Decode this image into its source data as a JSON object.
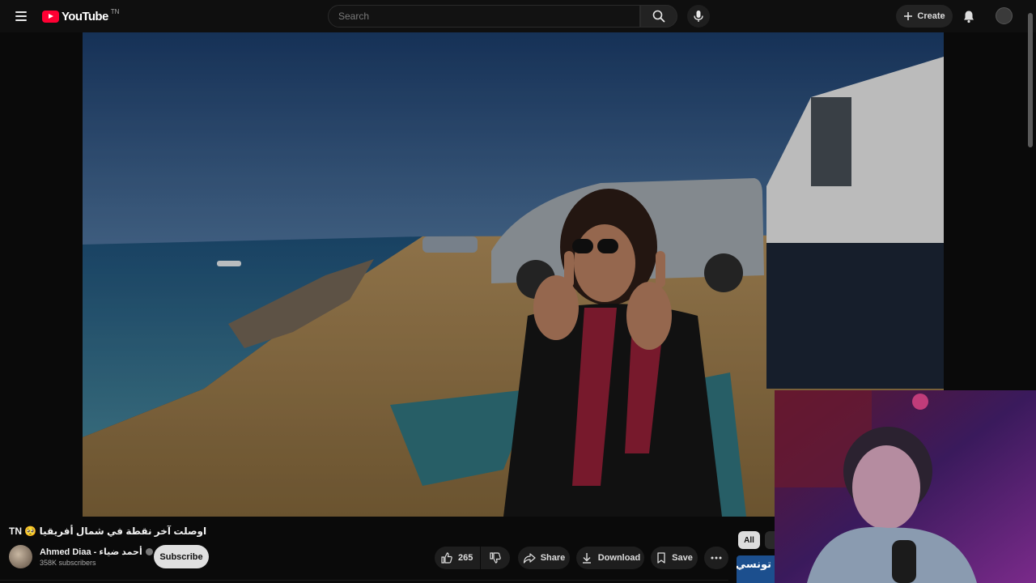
{
  "header": {
    "logo_text": "YouTube",
    "logo_region": "TN",
    "search_placeholder": "Search",
    "create_label": "Create"
  },
  "video": {
    "title": "TN 🥺 اوصلت آخر نقطة في شمال أفريقيا",
    "channel_name": "Ahmed Diaa - أحمد ضياء",
    "subscribers": "358K subscribers",
    "subscribe_label": "Subscribe"
  },
  "actions": {
    "like_count": "265",
    "share_label": "Share",
    "download_label": "Download",
    "save_label": "Save"
  },
  "sidebar": {
    "chip_all": "All",
    "next_thumbnail_text": "تونسي"
  },
  "colors": {
    "brand_red": "#ff0033",
    "background": "#0f0f0f",
    "pill_bg": "#1e1e1e",
    "subscribe_bg": "#e0e0e0"
  },
  "icons": [
    "menu-icon",
    "youtube-logo",
    "search-icon",
    "mic-icon",
    "plus-icon",
    "bell-icon",
    "verified-icon",
    "thumbs-up-icon",
    "thumbs-down-icon",
    "share-icon",
    "download-icon",
    "bookmark-icon",
    "more-horizontal-icon"
  ]
}
